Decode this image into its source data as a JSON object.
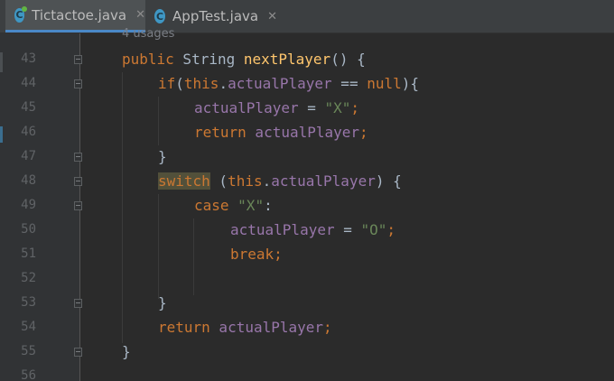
{
  "tabs": [
    {
      "label": "Tictactoe.java",
      "icon_letter": "C",
      "active": true
    },
    {
      "label": "AppTest.java",
      "icon_letter": "C",
      "active": false
    }
  ],
  "usages_hint": "4 usages",
  "line_numbers": [
    "43",
    "44",
    "45",
    "46",
    "47",
    "48",
    "49",
    "50",
    "51",
    "52",
    "53",
    "54",
    "55",
    "56"
  ],
  "code": {
    "l43": {
      "t1": "public",
      "t2": " String ",
      "t3": "nextPlayer",
      "t4": "() {"
    },
    "l44": {
      "t1": "if",
      "t2": "(",
      "t3": "this",
      "t4": ".",
      "t5": "actualPlayer",
      "t6": " == ",
      "t7": "null",
      "t8": "){"
    },
    "l45": {
      "t1": "actualPlayer",
      "t2": " = ",
      "t3": "\"X\"",
      "t4": ";"
    },
    "l46": {
      "t1": "return",
      "t2": " actualPlayer",
      "t3": ";"
    },
    "l47": {
      "t1": "}"
    },
    "l48": {
      "t1": "switch",
      "t2": " (",
      "t3": "this",
      "t4": ".",
      "t5": "actualPlayer",
      "t6": ") {"
    },
    "l49": {
      "t1": "case",
      "t2": " ",
      "t3": "\"X\"",
      "t4": ":"
    },
    "l50": {
      "t1": "actualPlayer",
      "t2": " = ",
      "t3": "\"O\"",
      "t4": ";"
    },
    "l51": {
      "t1": "break",
      "t2": ";"
    },
    "l53": {
      "t1": "}"
    },
    "l54": {
      "t1": "return",
      "t2": " actualPlayer",
      "t3": ";"
    },
    "l55": {
      "t1": "}"
    }
  },
  "colors": {
    "editor_bg": "#2b2b2b",
    "keyword": "#cc7832",
    "method": "#ffc66d",
    "field": "#9876aa",
    "string": "#6a8759",
    "text": "#a9b7c6",
    "active_tab_underline": "#4a88c7"
  }
}
